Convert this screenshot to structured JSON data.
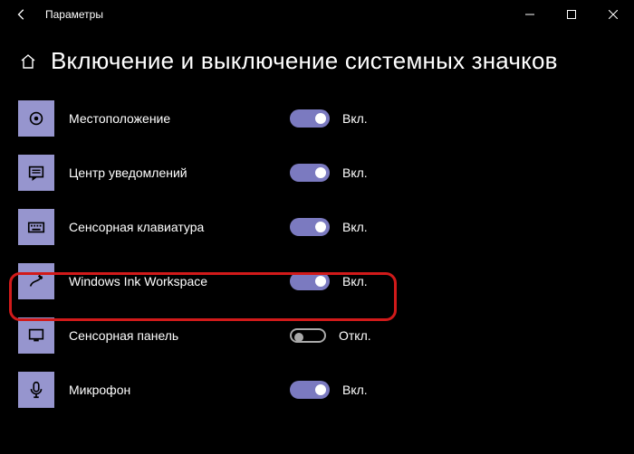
{
  "window": {
    "title": "Параметры"
  },
  "page": {
    "title": "Включение и выключение системных значков"
  },
  "toggle_labels": {
    "on": "Вкл.",
    "off": "Откл."
  },
  "items": [
    {
      "icon": "location",
      "label": "Местоположение",
      "state": "on"
    },
    {
      "icon": "action-center",
      "label": "Центр уведомлений",
      "state": "on"
    },
    {
      "icon": "touch-keyboard",
      "label": "Сенсорная клавиатура",
      "state": "on"
    },
    {
      "icon": "ink-workspace",
      "label": "Windows Ink Workspace",
      "state": "on"
    },
    {
      "icon": "touchpad",
      "label": "Сенсорная панель",
      "state": "off"
    },
    {
      "icon": "microphone",
      "label": "Микрофон",
      "state": "on"
    }
  ]
}
